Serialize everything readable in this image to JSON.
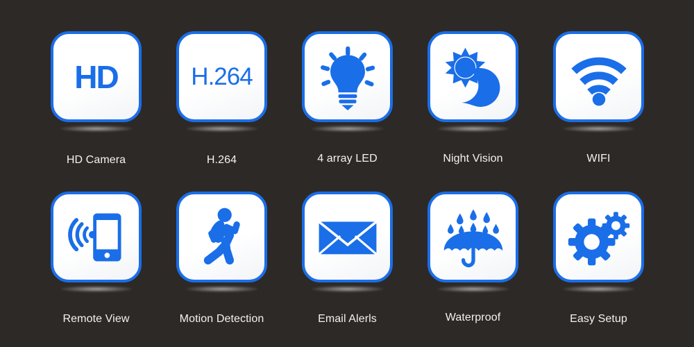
{
  "page": {
    "background_color": "#2d2926",
    "accent_color": "#1a6ee8",
    "label_color": "#f4f2f0",
    "tile_background": "#ffffff"
  },
  "features": [
    {
      "label": "HD Camera",
      "icon": "hd-wordmark-icon",
      "icon_text": "HD",
      "row": 1,
      "col": 1
    },
    {
      "label": "H.264",
      "icon": "h264-wordmark-icon",
      "icon_text": "H.264",
      "row": 1,
      "col": 2
    },
    {
      "label": "4 array LED",
      "icon": "lightbulb-rays-icon",
      "icon_text": "",
      "row": 1,
      "col": 3
    },
    {
      "label": "Night Vision",
      "icon": "sun-moon-icon",
      "icon_text": "",
      "row": 1,
      "col": 4
    },
    {
      "label": "WIFI",
      "icon": "wifi-signal-icon",
      "icon_text": "",
      "row": 1,
      "col": 5
    },
    {
      "label": "Remote View",
      "icon": "smartphone-signal-icon",
      "icon_text": "",
      "row": 2,
      "col": 1
    },
    {
      "label": "Motion Detection",
      "icon": "running-person-icon",
      "icon_text": "",
      "row": 2,
      "col": 2
    },
    {
      "label": "Email Alerls",
      "icon": "envelope-icon",
      "icon_text": "",
      "row": 2,
      "col": 3
    },
    {
      "label": "Waterproof",
      "icon": "umbrella-rain-icon",
      "icon_text": "",
      "row": 2,
      "col": 4
    },
    {
      "label": "Easy Setup",
      "icon": "gears-icon",
      "icon_text": "",
      "row": 2,
      "col": 5
    }
  ]
}
